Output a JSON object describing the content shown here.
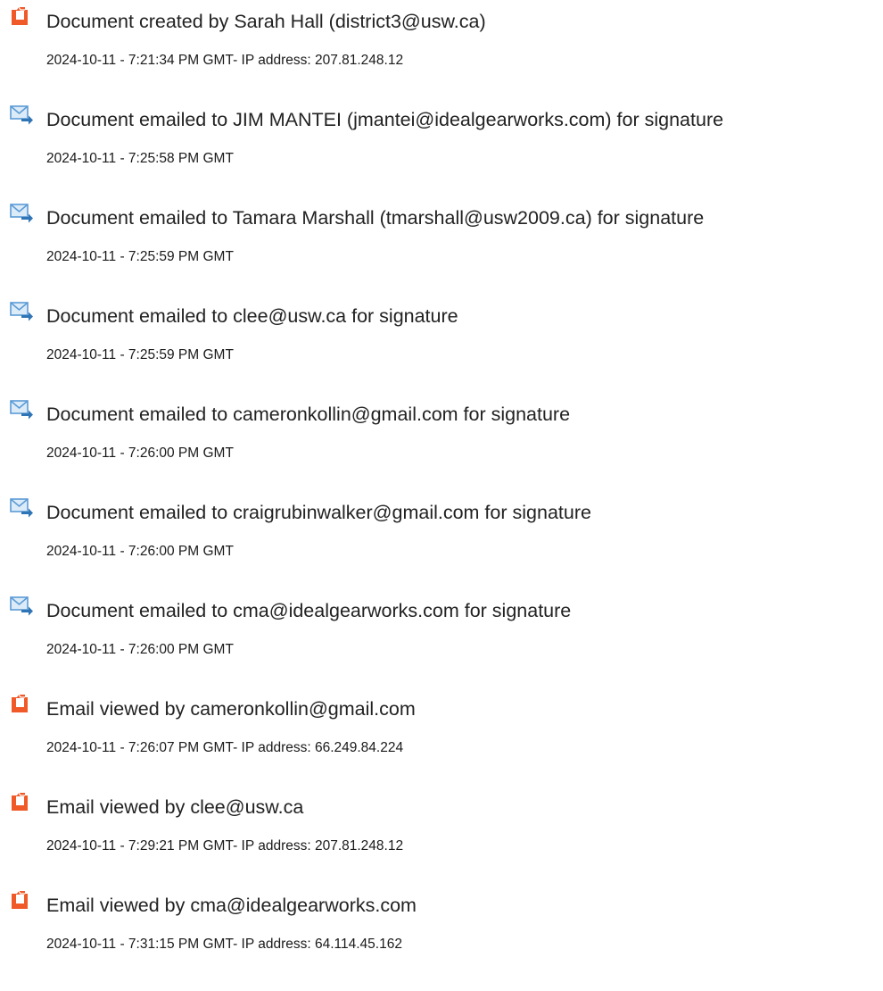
{
  "colors": {
    "text": "#222222",
    "icon_document_orange": "#F05A28",
    "icon_email_blue": "#5B9BD5",
    "icon_arrow_blue": "#2F75B5"
  },
  "entries": [
    {
      "icon": "document-icon",
      "title": "Document created by Sarah Hall (district3@usw.ca)",
      "meta": "2024-10-11 - 7:21:34 PM GMT- IP address: 207.81.248.12"
    },
    {
      "icon": "email-sent-icon",
      "title": "Document emailed to JIM MANTEI (jmantei@idealgearworks.com) for signature",
      "meta": "2024-10-11 - 7:25:58 PM GMT"
    },
    {
      "icon": "email-sent-icon",
      "title": "Document emailed to Tamara Marshall (tmarshall@usw2009.ca) for signature",
      "meta": "2024-10-11 - 7:25:59 PM GMT"
    },
    {
      "icon": "email-sent-icon",
      "title": "Document emailed to clee@usw.ca for signature",
      "meta": "2024-10-11 - 7:25:59 PM GMT"
    },
    {
      "icon": "email-sent-icon",
      "title": "Document emailed to cameronkollin@gmail.com for signature",
      "meta": "2024-10-11 - 7:26:00 PM GMT"
    },
    {
      "icon": "email-sent-icon",
      "title": "Document emailed to craigrubinwalker@gmail.com for signature",
      "meta": "2024-10-11 - 7:26:00 PM GMT"
    },
    {
      "icon": "email-sent-icon",
      "title": "Document emailed to cma@idealgearworks.com for signature",
      "meta": "2024-10-11 - 7:26:00 PM GMT"
    },
    {
      "icon": "document-icon",
      "title": "Email viewed by cameronkollin@gmail.com",
      "meta": "2024-10-11 - 7:26:07 PM GMT- IP address: 66.249.84.224"
    },
    {
      "icon": "document-icon",
      "title": "Email viewed by clee@usw.ca",
      "meta": "2024-10-11 - 7:29:21 PM GMT- IP address: 207.81.248.12"
    },
    {
      "icon": "document-icon",
      "title": "Email viewed by cma@idealgearworks.com",
      "meta": "2024-10-11 - 7:31:15 PM GMT- IP address: 64.114.45.162"
    }
  ]
}
